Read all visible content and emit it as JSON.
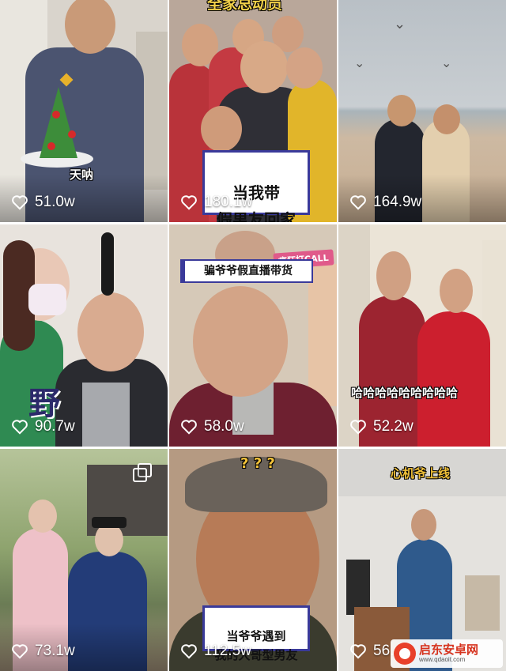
{
  "tiles": [
    {
      "caption": "天呐",
      "likes": "51.0w"
    },
    {
      "caption_top": "全家总动员",
      "caption_box": "当我带\n假男友回家",
      "likes": "180.1w"
    },
    {
      "likes": "164.9w"
    },
    {
      "caption_art": "野",
      "likes": "90.7w"
    },
    {
      "caption_box": "骗爷爷假直播带货",
      "badge": "疯狂打CALL",
      "likes": "58.0w"
    },
    {
      "caption": "哈哈哈哈哈哈哈哈哈",
      "likes": "52.2w"
    },
    {
      "icon": "multi-image-icon",
      "likes": "73.1w"
    },
    {
      "caption_top": "? ? ?",
      "caption_box": "当爷爷遇到\n我的大哥型男友",
      "likes": "112.5w"
    },
    {
      "caption_top": "心机爷上线",
      "likes": "56.",
      "watermark": "启东安卓网",
      "watermark_url": "www.qdaoit.com"
    }
  ]
}
